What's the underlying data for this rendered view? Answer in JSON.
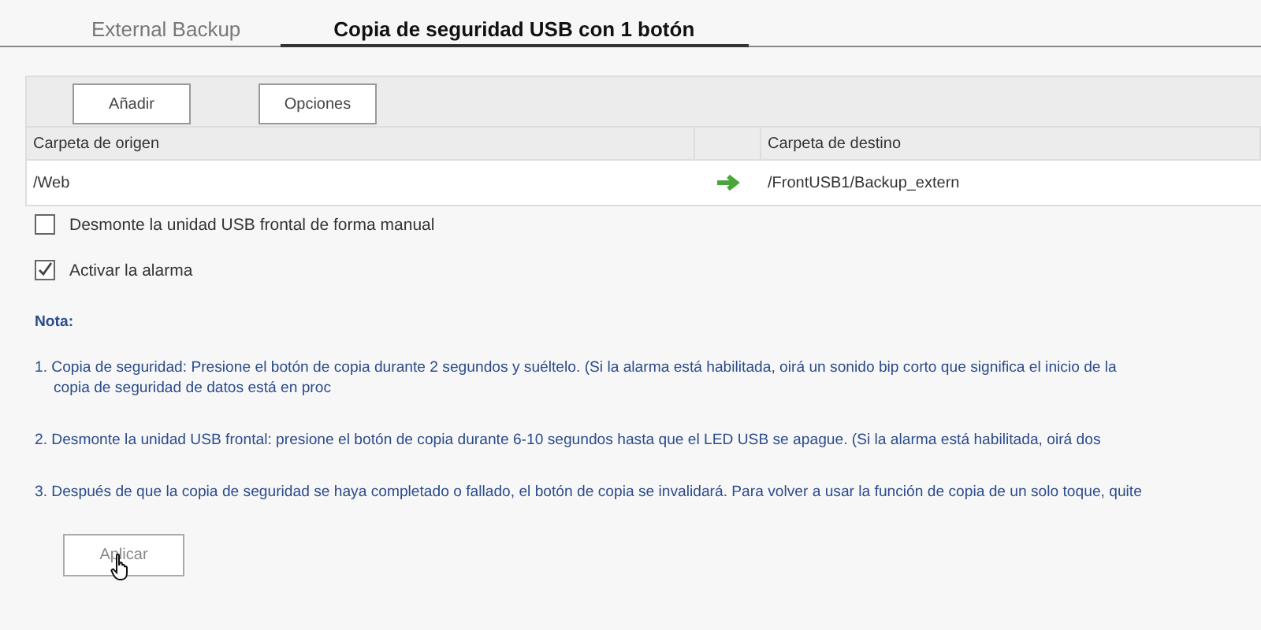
{
  "tabs": [
    {
      "label": "External Backup",
      "selected": false
    },
    {
      "label": "Copia de seguridad USB con 1 botón",
      "selected": true
    }
  ],
  "toolbar": {
    "buttons": [
      "Añadir",
      "Opciones"
    ]
  },
  "table": {
    "columns": [
      "Carpeta de origen",
      "Carpeta de destino"
    ],
    "rows": [
      {
        "source": "/Web",
        "destination": "/FrontUSB1/Backup_extern"
      }
    ]
  },
  "options": [
    {
      "label": "Desmonte la unidad USB frontal de forma manual",
      "checked": false
    },
    {
      "label": "Activar la alarma",
      "checked": true
    }
  ],
  "note": {
    "title": "Nota:",
    "items": [
      {
        "lines": [
          "1. Copia de seguridad: Presione el botón de copia durante 2 segundos y suéltelo. (Si la alarma está habilitada, oirá un sonido bip corto que significa el inicio de la",
          "copia de seguridad de datos está en proc"
        ]
      },
      {
        "lines": [
          "2. Desmonte la unidad USB frontal: presione el botón de copia durante 6-10 segundos hasta que el LED USB se apague. (Si la alarma está habilitada, oirá dos"
        ]
      },
      {
        "lines": [
          "3. Después de que la copia de seguridad se haya completado o fallado, el botón de copia se invalidará. Para volver a usar la función de copia de un solo toque, quite"
        ]
      }
    ]
  },
  "apply_button": "Aplicar"
}
